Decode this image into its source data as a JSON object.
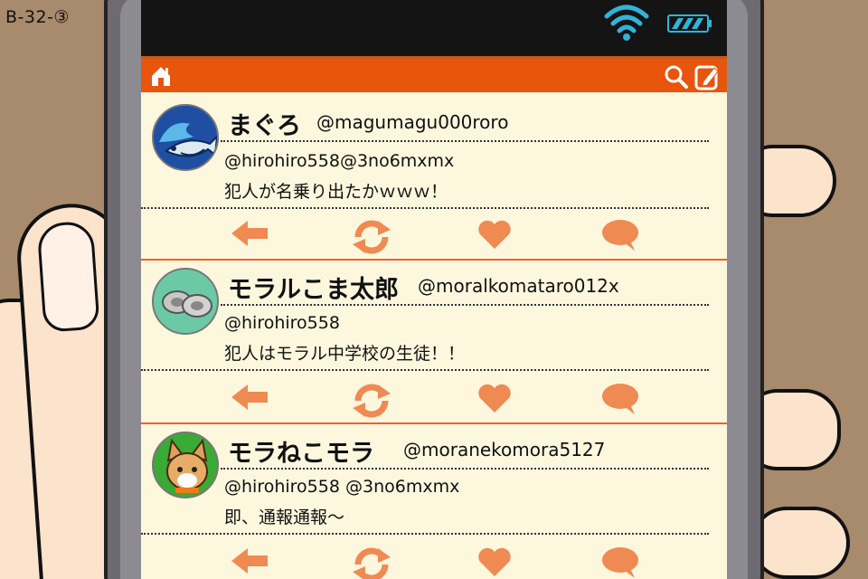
{
  "panel_code": "B-32-③",
  "colors": {
    "accent": "#e8550c",
    "icon": "#ef8a52",
    "screen_bg": "#fdf7de",
    "status_bar": "#141414",
    "status_icons": "#32b3d8"
  },
  "icons": {
    "home": "home-icon",
    "search": "search-icon",
    "compose": "compose-icon",
    "reply": "arrow-left-icon",
    "retweet": "retweet-icon",
    "like": "heart-icon",
    "comment": "speech-bubble-icon"
  },
  "posts": [
    {
      "name": "まぐろ",
      "handle": "@magumagu000roro",
      "line1": "@hirohiro558@3no6mxmx",
      "line2": "犯人が名乗り出たかｗｗｗ！"
    },
    {
      "name": "モラルこま太郎",
      "handle": "@moralkomataro012x",
      "line1": "@hirohiro558",
      "line2": "犯人はモラル中学校の生徒！！"
    },
    {
      "name": "モラねこモラ",
      "handle": "@moranekomora5127",
      "line1": "@hirohiro558 @3no6mxmx",
      "line2": "即、通報通報～"
    }
  ]
}
